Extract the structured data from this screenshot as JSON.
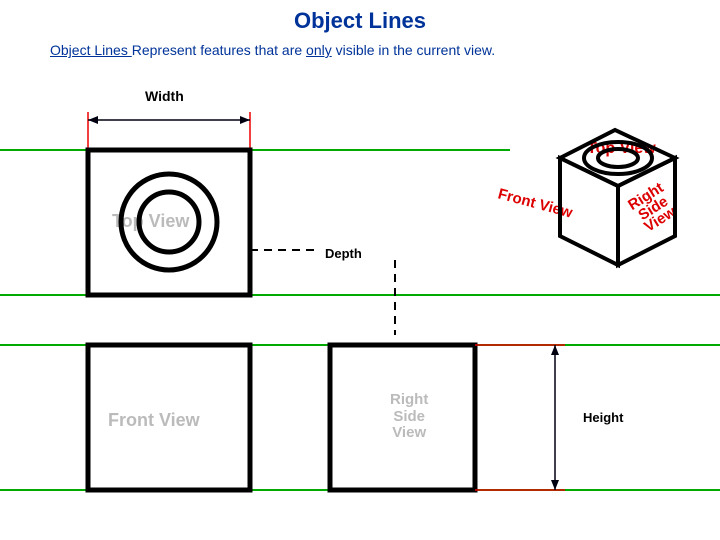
{
  "title": "Object Lines",
  "subtitle_lead": "Object Lines ",
  "subtitle_mid": "Represent features that are ",
  "subtitle_only": "only",
  "subtitle_end": " visible in the current view.",
  "labels": {
    "width": "Width",
    "depth": "Depth",
    "height": "Height",
    "top_view": "Top View",
    "front_view": "Front View",
    "right_side_view": "Right\nSide\nView"
  },
  "iso_labels": {
    "top": "Top View",
    "front": "Front View",
    "right": "Right\nSide\nView"
  }
}
